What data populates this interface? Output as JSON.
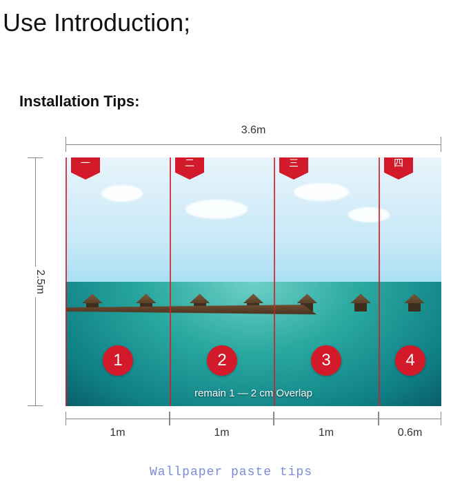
{
  "page_title": "Use Introduction;",
  "subtitle": "Installation Tips:",
  "total_width_label": "3.6m",
  "total_height_label": "2.5m",
  "panels": [
    {
      "tab_glyph": "一",
      "circle_number": "1",
      "width_label": "1m"
    },
    {
      "tab_glyph": "二",
      "circle_number": "2",
      "width_label": "1m"
    },
    {
      "tab_glyph": "三",
      "circle_number": "3",
      "width_label": "1m"
    },
    {
      "tab_glyph": "四",
      "circle_number": "4",
      "width_label": "0.6m"
    }
  ],
  "overlap_note": "remain 1 — 2 cm Overlap",
  "caption": "Wallpaper paste tips",
  "colors": {
    "accent_red": "#d31a2b",
    "caption_blue": "#7a8bd8"
  }
}
